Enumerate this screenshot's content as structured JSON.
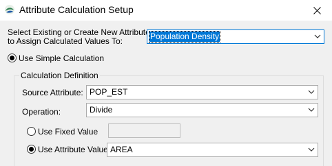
{
  "window": {
    "title": "Attribute Calculation Setup",
    "close_icon": "close-icon"
  },
  "attribute": {
    "label_line1": "Select Existing or Create New Attribute",
    "label_line2": "to Assign Calculated Values To:",
    "value": "Population Density"
  },
  "simple_calc": {
    "label": "Use Simple Calculation",
    "selected": true
  },
  "definition": {
    "title": "Calculation Definition",
    "source_label": "Source Attribute:",
    "source_value": "POP_EST",
    "operation_label": "Operation:",
    "operation_value": "Divide",
    "fixed_label": "Use Fixed Value",
    "fixed_value": "",
    "fixed_selected": false,
    "attr_value_label": "Use Attribute Value",
    "attr_value_value": "AREA",
    "attr_value_selected": true
  },
  "colors": {
    "selection": "#0078d7",
    "background": "#f0f0f0"
  }
}
